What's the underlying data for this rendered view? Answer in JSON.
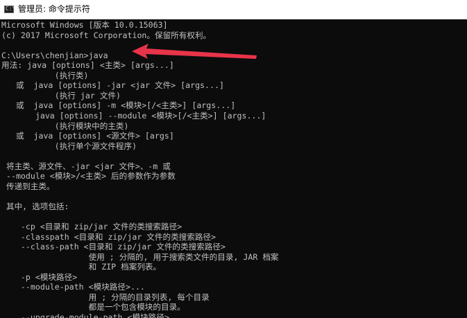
{
  "window": {
    "title": "管理员: 命令提示符",
    "icon": "cmd-console-icon",
    "icon_glyph": "C:\\"
  },
  "console": {
    "lines": [
      "Microsoft Windows [版本 10.0.15063]",
      "(c) 2017 Microsoft Corporation。保留所有权利。",
      "",
      "C:\\Users\\chenjian>java",
      "用法: java [options] <主类> [args...]",
      "           (执行类)",
      "   或  java [options] -jar <jar 文件> [args...]",
      "           (执行 jar 文件)",
      "   或  java [options] -m <模块>[/<主类>] [args...]",
      "       java [options] --module <模块>[/<主类>] [args...]",
      "           (执行模块中的主类)",
      "   或  java [options] <源文件> [args]",
      "           (执行单个源文件程序)",
      "",
      " 将主类、源文件、-jar <jar 文件>、-m 或",
      " --module <模块>/<主类> 后的参数作为参数",
      " 传递到主类。",
      "",
      " 其中, 选项包括:",
      "",
      "    -cp <目录和 zip/jar 文件的类搜索路径>",
      "    -classpath <目录和 zip/jar 文件的类搜索路径>",
      "    --class-path <目录和 zip/jar 文件的类搜索路径>",
      "                  使用 ; 分隔的, 用于搜索类文件的目录, JAR 档案",
      "                  和 ZIP 档案列表。",
      "    -p <模块路径>",
      "    --module-path <模块路径>...",
      "                  用 ; 分隔的目录列表, 每个目录",
      "                  都是一个包含模块的目录。",
      "    --upgrade-module-path <模块路径>..."
    ]
  },
  "annotation": {
    "color": "#e8344a",
    "icon": "red-arrow-icon"
  },
  "colors": {
    "console_background": "#0c0c0c",
    "console_text": "#c0c0c0",
    "titlebar_background": "#ffffff"
  }
}
